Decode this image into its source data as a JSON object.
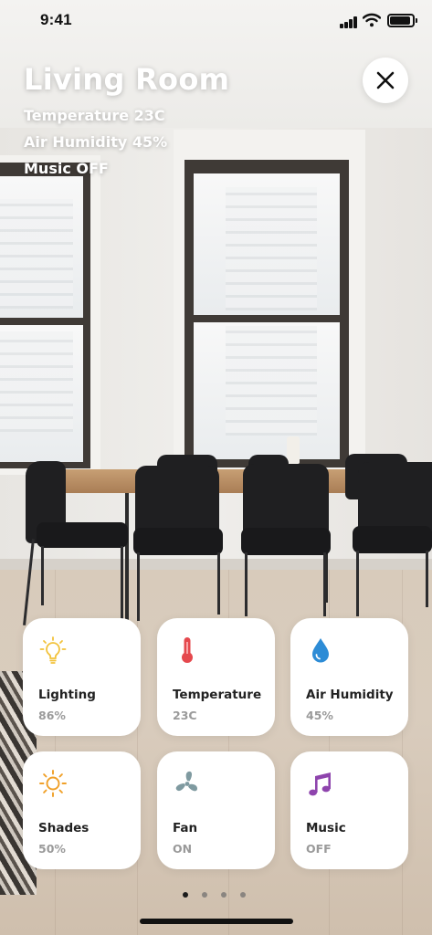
{
  "status_bar": {
    "time": "9:41"
  },
  "room": {
    "title": "Living Room",
    "stats": [
      "Temperature 23C",
      "Air Humidity 45%",
      "Music OFF"
    ]
  },
  "tiles": [
    {
      "label": "Lighting",
      "value": "86%",
      "icon": "light-bulb-icon",
      "color": "#f2c23a"
    },
    {
      "label": "Temperature",
      "value": "23C",
      "icon": "thermometer-icon",
      "color": "#e5484d"
    },
    {
      "label": "Air Humidity",
      "value": "45%",
      "icon": "water-drop-icon",
      "color": "#2d8cd6"
    },
    {
      "label": "Shades",
      "value": "50%",
      "icon": "sun-icon",
      "color": "#f0a028"
    },
    {
      "label": "Fan",
      "value": "ON",
      "icon": "fan-icon",
      "color": "#7f9aa0"
    },
    {
      "label": "Music",
      "value": "OFF",
      "icon": "music-note-icon",
      "color": "#8e44ad"
    }
  ],
  "pager": {
    "count": 4,
    "active_index": 0
  }
}
